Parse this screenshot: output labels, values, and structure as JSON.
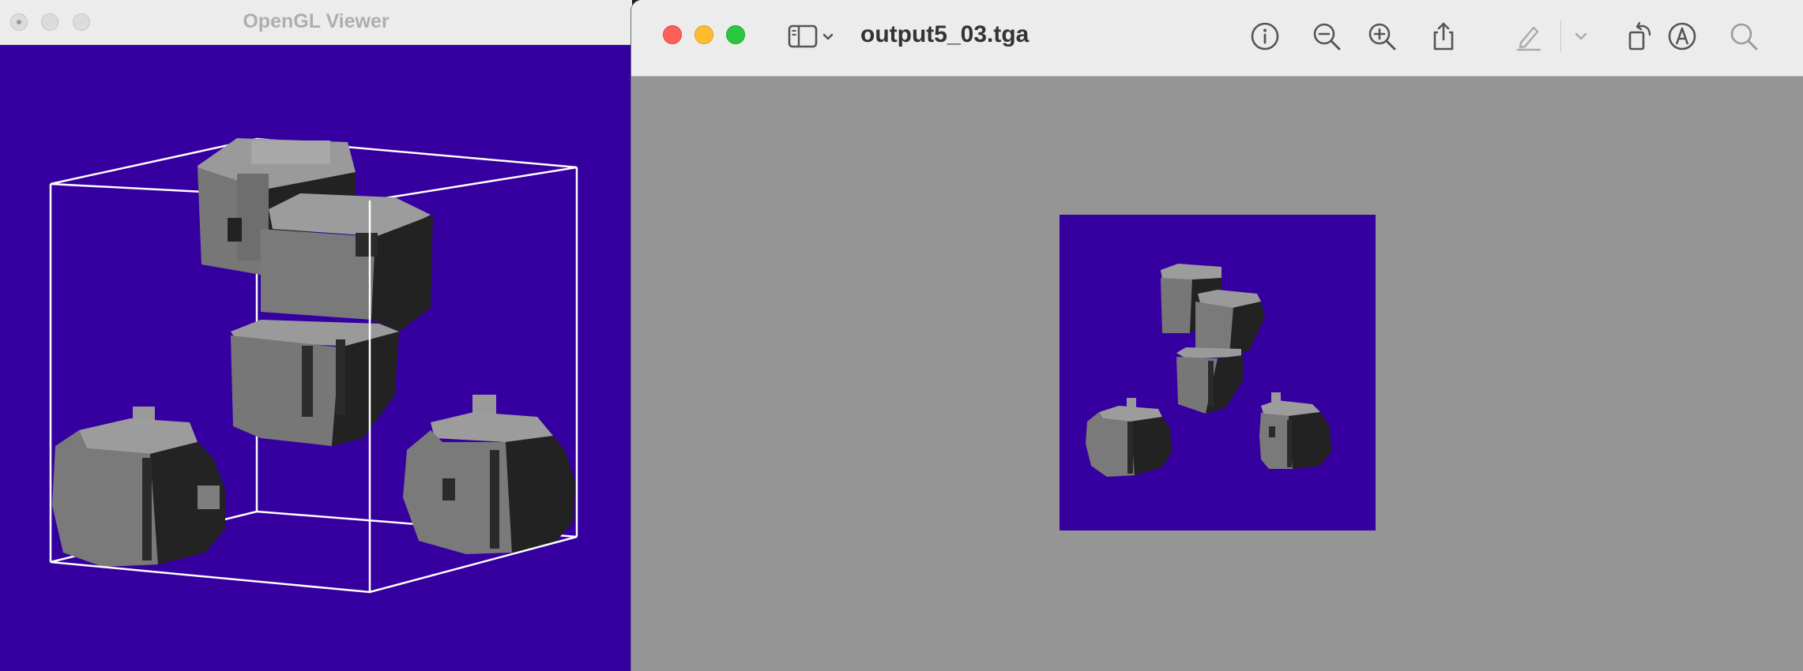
{
  "gl_window": {
    "title": "OpenGL Viewer",
    "background_color": "#3600a0",
    "wireframe_color": "#ffffff",
    "voxel_colors": {
      "top": "#9a9a9a",
      "front": "#727272",
      "side": "#222222"
    }
  },
  "preview_window": {
    "filename": "output5_03.tga",
    "background_color": "#959595",
    "image_background_color": "#3600a0",
    "toolbar_icons": [
      "sidebar-toggle-icon",
      "chevron-down-icon",
      "info-icon",
      "zoom-out-icon",
      "zoom-in-icon",
      "share-icon",
      "markup-pencil-icon",
      "chevron-down-icon",
      "rotate-icon",
      "annotate-icon",
      "search-icon"
    ]
  }
}
